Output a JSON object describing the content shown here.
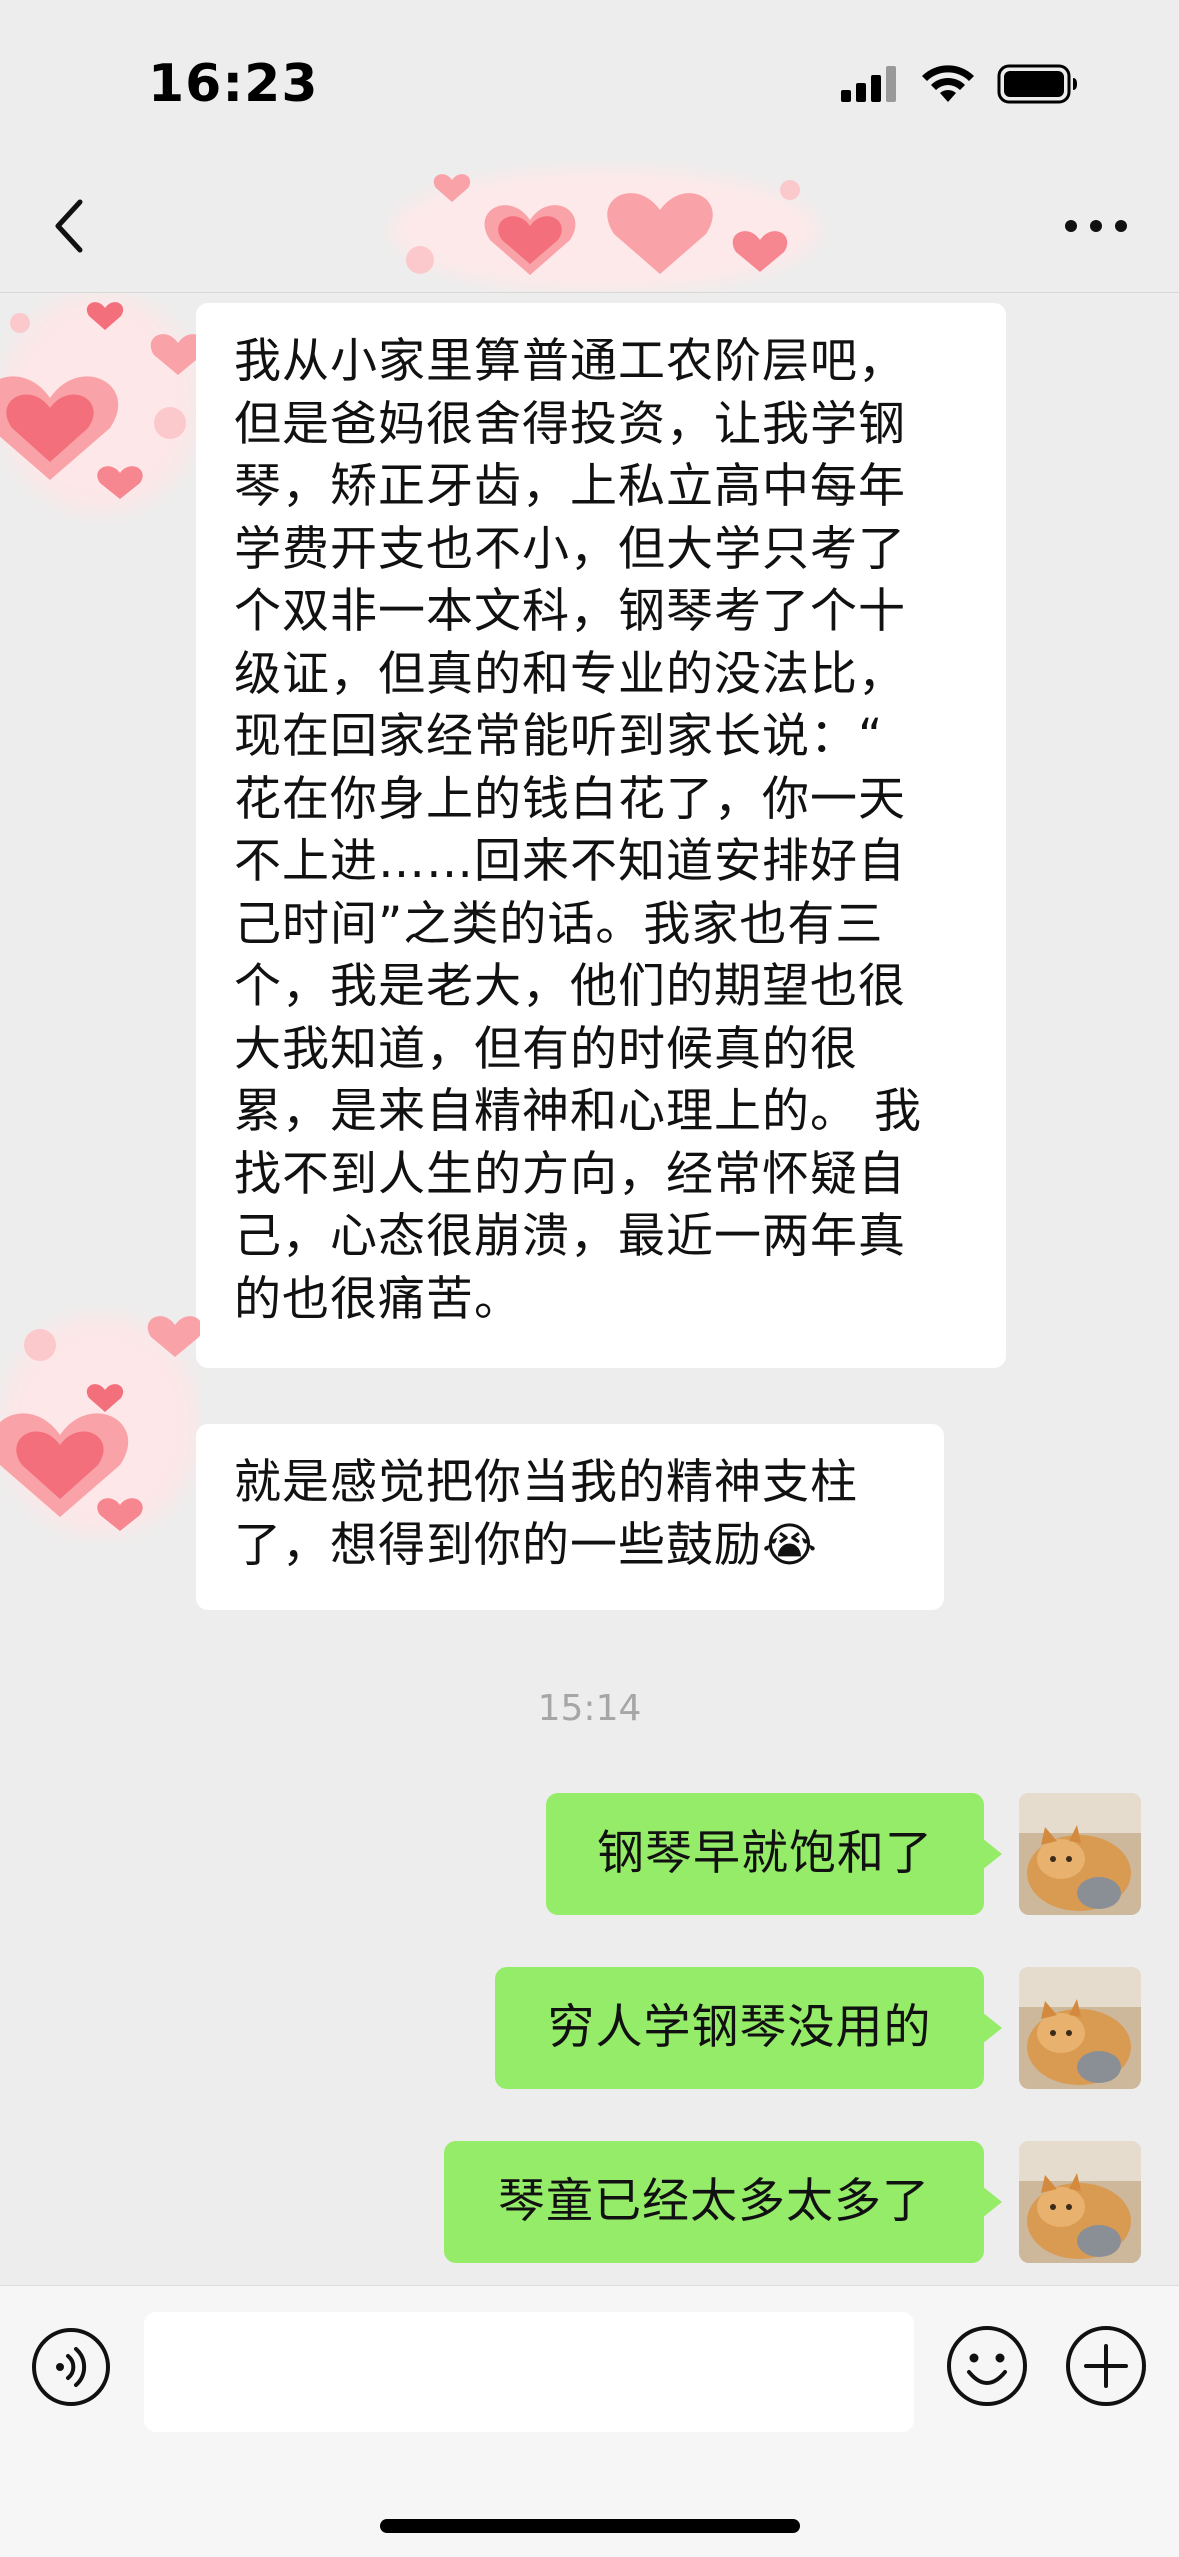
{
  "status_bar": {
    "time": "16:23",
    "icons": [
      "signal-icon",
      "wifi-icon",
      "battery-icon"
    ]
  },
  "nav": {
    "back_icon": "chevron-left-icon",
    "more_icon": "more-dots-icon"
  },
  "messages": [
    {
      "side": "incoming",
      "lines": [
        "我从小家里算普通工农阶层吧，",
        "但是爸妈很舍得投资，让我学钢",
        "琴，矫正牙齿，上私立高中每年",
        "学费开支也不小，但大学只考了",
        "个双非一本文科，钢琴考了个十",
        "级证，但真的和专业的没法比，",
        "现在回家经常能听到家长说：“",
        "花在你身上的钱白花了，你一天",
        "不上进……回来不知道安排好自",
        "己时间”之类的话。我家也有三",
        "个，我是老大，他们的期望也很",
        "大我知道，但有的时候真的很",
        "累，是来自精神和心理上的。 我",
        "找不到人生的方向，经常怀疑自",
        "己，心态很崩溃，最近一两年真",
        "的也很痛苦。"
      ]
    },
    {
      "side": "incoming",
      "lines": [
        "就是感觉把你当我的精神支柱",
        "了，想得到你的一些鼓励😭"
      ]
    }
  ],
  "timestamp": "15:14",
  "outgoing": [
    {
      "text": "钢琴早就饱和了"
    },
    {
      "text": "穷人学钢琴没用的"
    },
    {
      "text": "琴童已经太多太多了"
    }
  ],
  "input_bar": {
    "placeholder": "",
    "icons": [
      "voice-icon",
      "emoji-icon",
      "plus-icon"
    ]
  },
  "colors": {
    "background": "#ededed",
    "outgoing_bubble": "#95ec69",
    "incoming_bubble": "#ffffff",
    "timestamp": "#a6a6a6"
  }
}
